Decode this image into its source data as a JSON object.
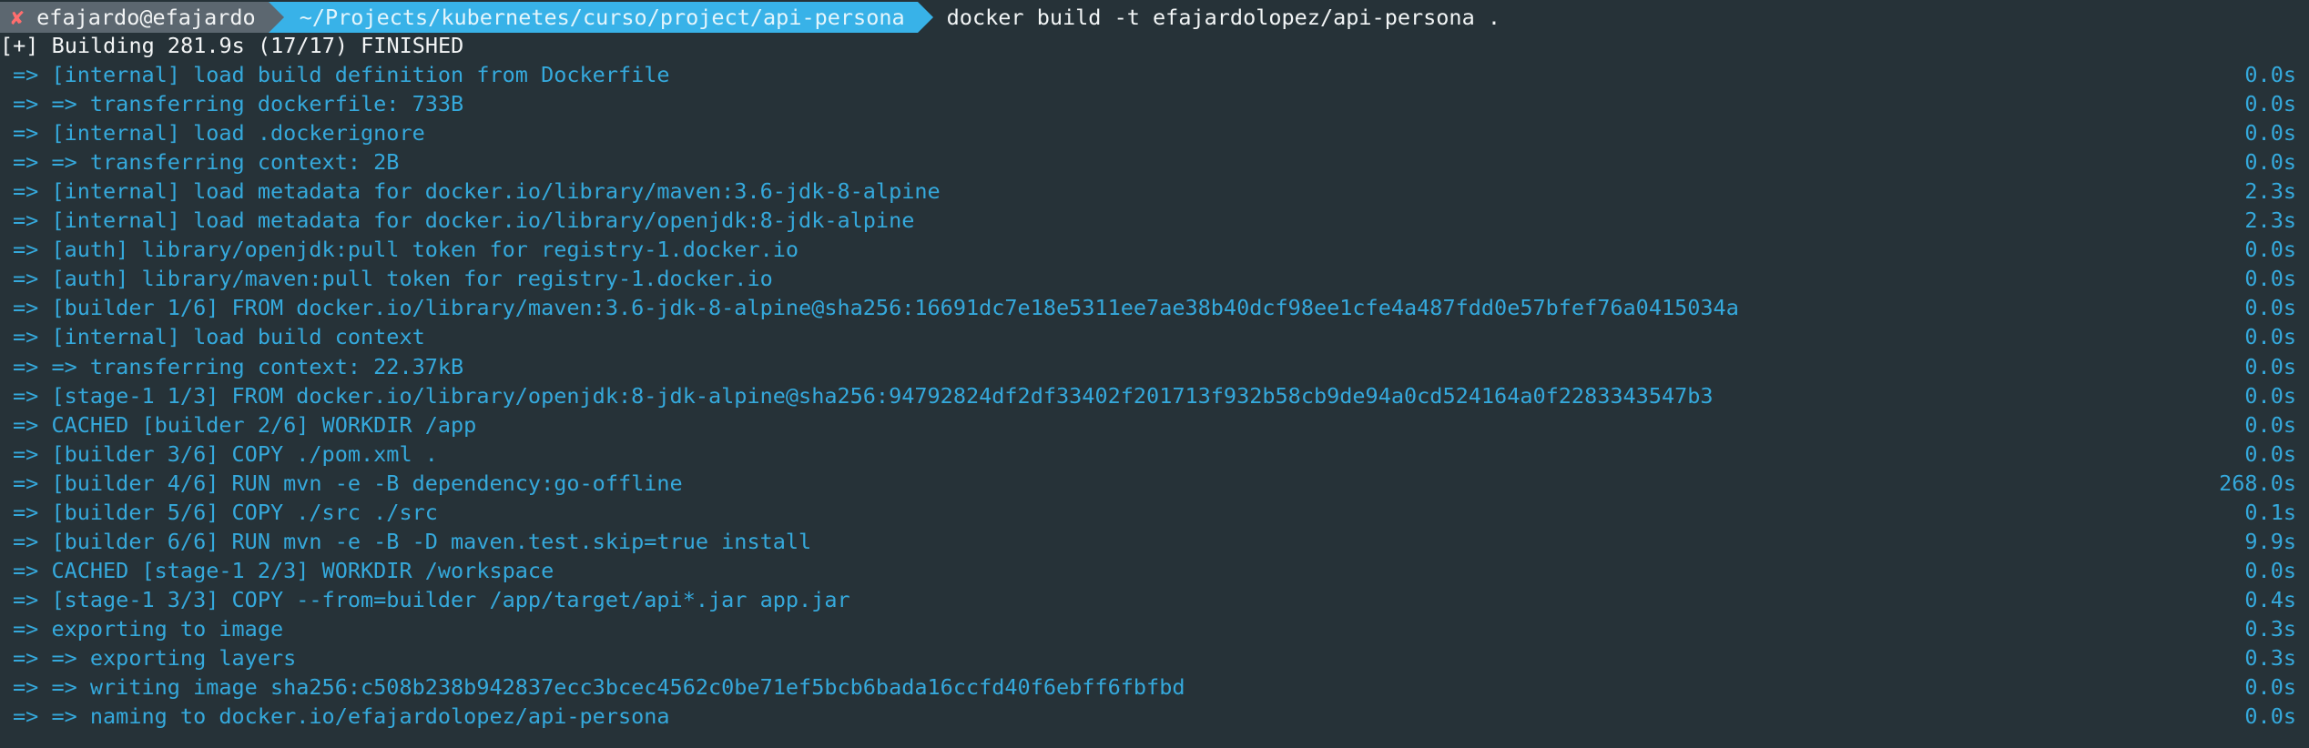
{
  "prompt": {
    "error_mark": "✘",
    "user_host": "efajardo@efajardo",
    "path": "~/Projects/kubernetes/curso/project/api-persona",
    "command": "docker build -t efajardolopez/api-persona ."
  },
  "build_status": "[+] Building 281.9s (17/17) FINISHED",
  "steps": [
    {
      "text": "=> [internal] load build definition from Dockerfile",
      "time": "0.0s"
    },
    {
      "text": "=> => transferring dockerfile: 733B",
      "time": "0.0s"
    },
    {
      "text": "=> [internal] load .dockerignore",
      "time": "0.0s"
    },
    {
      "text": "=> => transferring context: 2B",
      "time": "0.0s"
    },
    {
      "text": "=> [internal] load metadata for docker.io/library/maven:3.6-jdk-8-alpine",
      "time": "2.3s"
    },
    {
      "text": "=> [internal] load metadata for docker.io/library/openjdk:8-jdk-alpine",
      "time": "2.3s"
    },
    {
      "text": "=> [auth] library/openjdk:pull token for registry-1.docker.io",
      "time": "0.0s"
    },
    {
      "text": "=> [auth] library/maven:pull token for registry-1.docker.io",
      "time": "0.0s"
    },
    {
      "text": "=> [builder 1/6] FROM docker.io/library/maven:3.6-jdk-8-alpine@sha256:16691dc7e18e5311ee7ae38b40dcf98ee1cfe4a487fdd0e57bfef76a0415034a",
      "time": "0.0s"
    },
    {
      "text": "=> [internal] load build context",
      "time": "0.0s"
    },
    {
      "text": "=> => transferring context: 22.37kB",
      "time": "0.0s"
    },
    {
      "text": "=> [stage-1 1/3] FROM docker.io/library/openjdk:8-jdk-alpine@sha256:94792824df2df33402f201713f932b58cb9de94a0cd524164a0f2283343547b3",
      "time": "0.0s"
    },
    {
      "text": "=> CACHED [builder 2/6] WORKDIR /app",
      "time": "0.0s"
    },
    {
      "text": "=> [builder 3/6] COPY ./pom.xml .",
      "time": "0.0s"
    },
    {
      "text": "=> [builder 4/6] RUN mvn -e -B dependency:go-offline",
      "time": "268.0s"
    },
    {
      "text": "=> [builder 5/6] COPY ./src ./src",
      "time": "0.1s"
    },
    {
      "text": "=> [builder 6/6] RUN mvn -e -B -D maven.test.skip=true install",
      "time": "9.9s"
    },
    {
      "text": "=> CACHED [stage-1 2/3] WORKDIR /workspace",
      "time": "0.0s"
    },
    {
      "text": "=> [stage-1 3/3] COPY --from=builder /app/target/api*.jar app.jar",
      "time": "0.4s"
    },
    {
      "text": "=> exporting to image",
      "time": "0.3s"
    },
    {
      "text": "=> => exporting layers",
      "time": "0.3s"
    },
    {
      "text": "=> => writing image sha256:c508b238b942837ecc3bcec4562c0be71ef5bcb6bada16ccfd40f6ebff6fbfbd",
      "time": "0.0s"
    },
    {
      "text": "=> => naming to docker.io/efajardolopez/api-persona",
      "time": "0.0s"
    }
  ],
  "colors": {
    "background": "#263238",
    "user_segment": "#5c6770",
    "path_segment": "#38b2e8",
    "step_text": "#35a9dc",
    "error_mark": "#ff6e6e"
  }
}
